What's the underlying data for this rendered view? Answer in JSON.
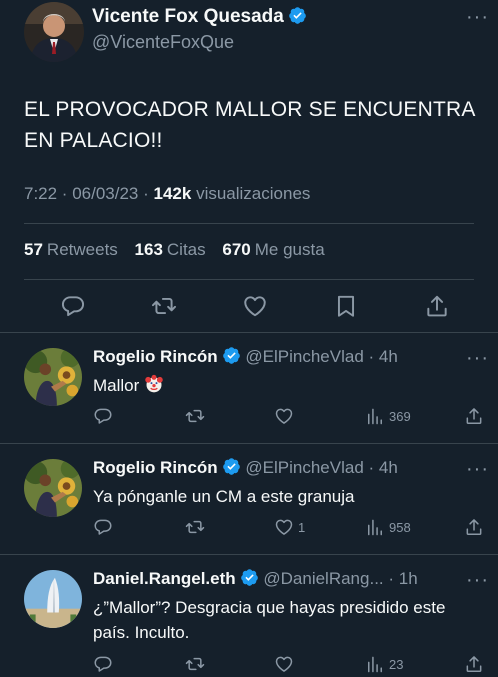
{
  "main_tweet": {
    "author_name": "Vicente Fox Quesada",
    "author_handle": "@VicenteFoxQue",
    "text": "EL PROVOCADOR MALLOR SE ENCUENTRA EN PALACIO!!",
    "time": "7:22 · 06/03/23 ·",
    "views_count": "142k",
    "views_label": "visualizaciones",
    "retweets_count": "57",
    "retweets_label": "Retweets",
    "quotes_count": "163",
    "quotes_label": "Citas",
    "likes_count": "670",
    "likes_label": "Me gusta"
  },
  "replies": [
    {
      "name": "Rogelio Rincón",
      "handle": "@ElPincheVlad",
      "time": "· 4h",
      "text": "Mallor",
      "emoji": "clown-face-icon",
      "likes": "",
      "views": "369"
    },
    {
      "name": "Rogelio Rincón",
      "handle": "@ElPincheVlad",
      "time": "· 4h",
      "text": "Ya pónganle un CM a este granuja",
      "likes": "1",
      "views": "958"
    },
    {
      "name": "Daniel.Rangel.eth",
      "handle": "@DanielRang...",
      "time": "· 1h",
      "text": "¿”Mallor”? Desgracia que hayas presidido este país. Inculto.",
      "likes": "",
      "views": "23"
    }
  ],
  "colors": {
    "background": "#15202b",
    "text": "#f7f9f9",
    "secondary": "#8b98a5",
    "verified": "#1d9bf0",
    "divider": "#38444d"
  }
}
